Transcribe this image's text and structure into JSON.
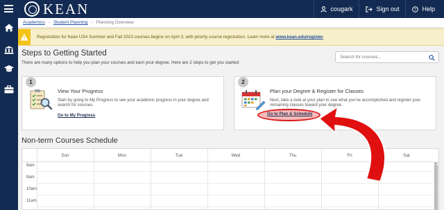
{
  "app": {
    "brand": "KEAN"
  },
  "topnav": {
    "user": "cougark",
    "signout": "Sign out",
    "help": "Help"
  },
  "rail": {
    "icons": [
      "home-icon",
      "bank-icon",
      "graduation-cap-icon",
      "briefcase-icon"
    ]
  },
  "breadcrumb": {
    "items": [
      "Academics",
      "Student Planning",
      "Planning Overview"
    ]
  },
  "notice": {
    "text": "Registration for Kean USA Summer and Fall 2023 courses begins on April 3, with priority course registration. Learn more at ",
    "link": "www.kean.edu/register",
    "suffix": "."
  },
  "steps": {
    "title": "Steps to Getting Started",
    "subtitle": "There are many options to help you plan your courses and earn your degree. Here are 2 steps to get you started:"
  },
  "search": {
    "placeholder": "Search for courses..."
  },
  "cards": [
    {
      "number": "1",
      "title": "View Your Progress",
      "description": "Start by going to My Progress to see your academic progress in your degree and search for courses.",
      "link": "Go to My Progress"
    },
    {
      "number": "2",
      "title": "Plan your Degree & Register for Classes",
      "description": "Next, take a look at your plan to see what you've accomplished and register your remaining classes toward your degree.",
      "link": "Go to Plan & Schedule"
    }
  ],
  "schedule": {
    "title": "Non-term Courses Schedule",
    "days": [
      "Sun",
      "Mon",
      "Tue",
      "Wed",
      "Thu",
      "Fri",
      "Sat"
    ],
    "times": [
      "8am",
      "9am",
      "10am",
      "11am"
    ]
  },
  "colors": {
    "navy": "#132b52",
    "warning": "#f3c318",
    "highlight": "#d81a1a"
  }
}
